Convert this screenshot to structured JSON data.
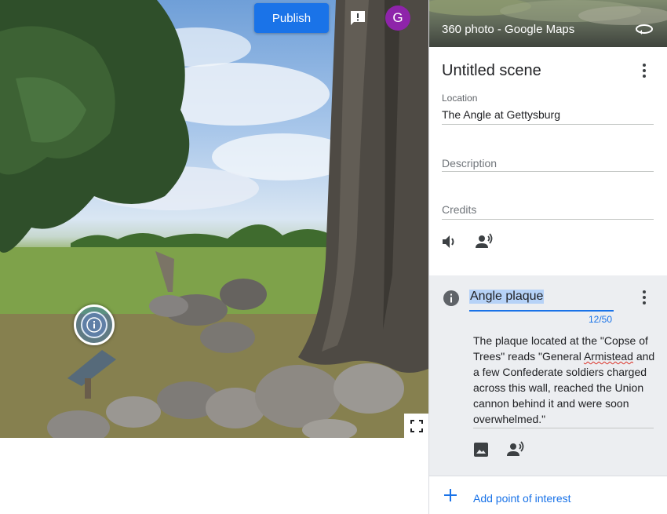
{
  "viewer": {
    "publish_label": "Publish",
    "avatar_letter": "G",
    "icons": {
      "feedback": "feedback-icon",
      "poi_marker": "info-icon",
      "fullscreen": "fullscreen-icon"
    }
  },
  "panel": {
    "header_title": "360 photo - Google Maps",
    "scene_title": "Untitled scene",
    "location_label": "Location",
    "location_value": "The Angle at Gettysburg",
    "description_placeholder": "Description",
    "credits_placeholder": "Credits",
    "icons": [
      "volume-icon",
      "voice-narration-icon",
      "more-vert-icon",
      "rotate-360-icon"
    ]
  },
  "poi": {
    "title": "Angle plaque",
    "counter": "12/50",
    "description_parts": [
      "The plaque located at the \"Copse of Trees\" reads \"General ",
      "Armistead",
      " and a few Confederate soldiers charged across this wall, reached the Union cannon behind it and were soon overwhelmed.\""
    ],
    "icons": [
      "info-icon",
      "image-icon",
      "voice-narration-icon",
      "more-vert-icon"
    ]
  },
  "add_poi_label": "Add point of interest",
  "colors": {
    "accent": "#1a73e8",
    "avatar": "#8e24aa",
    "poi_card_bg": "#eceef1",
    "selection": "#b6d2f7"
  }
}
